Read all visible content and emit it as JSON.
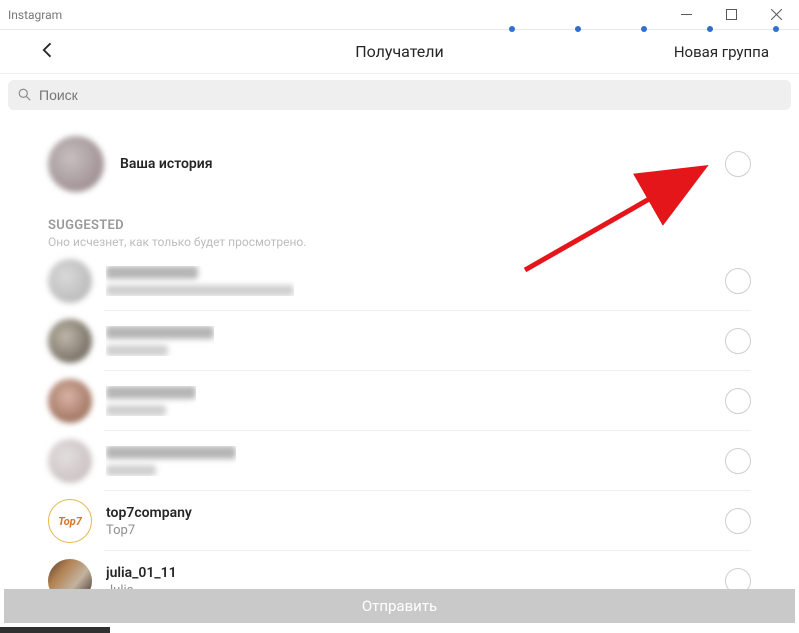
{
  "window": {
    "title": "Instagram"
  },
  "header": {
    "title": "Получатели",
    "new_group": "Новая группа"
  },
  "search": {
    "placeholder": "Поиск"
  },
  "story": {
    "label": "Ваша история"
  },
  "suggested": {
    "title": "SUGGESTED",
    "subtitle": "Оно исчезнет, как только будет просмотрено."
  },
  "recipients": [
    {
      "name": "",
      "sub": "",
      "blurred": true,
      "name_w": 92,
      "sub_w": 188
    },
    {
      "name": "",
      "sub": "",
      "blurred": true,
      "name_w": 108,
      "sub_w": 62
    },
    {
      "name": "",
      "sub": "",
      "blurred": true,
      "name_w": 90,
      "sub_w": 60
    },
    {
      "name": "",
      "sub": "",
      "blurred": true,
      "name_w": 130,
      "sub_w": 50
    },
    {
      "name": "top7company",
      "sub": "Top7",
      "blurred": false
    },
    {
      "name": "julia_01_11",
      "sub": "Julia",
      "blurred": false
    }
  ],
  "footer": {
    "send": "Отправить"
  }
}
